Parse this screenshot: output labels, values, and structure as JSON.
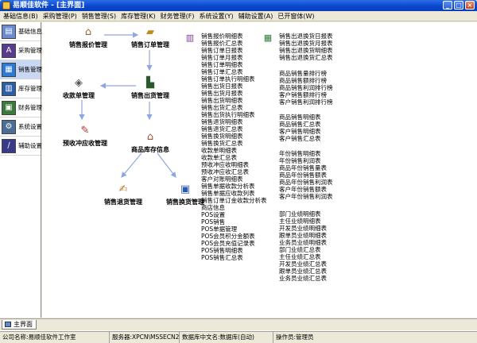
{
  "window": {
    "title": "易顺佳软件 - [主界面]"
  },
  "menu": [
    "基础信息(B)",
    "采购管理(P)",
    "销售管理(S)",
    "库存管理(K)",
    "财务管理(F)",
    "系统设置(Y)",
    "辅助设置(A)",
    "已开窗体(W)"
  ],
  "sidebar": {
    "items": [
      {
        "label": "基础信息",
        "icon": "folder-icon"
      },
      {
        "label": "采购管理",
        "icon": "purchase-icon"
      },
      {
        "label": "销售管理",
        "icon": "sales-icon"
      },
      {
        "label": "库存管理",
        "icon": "stock-icon"
      },
      {
        "label": "财务管理",
        "icon": "finance-icon"
      },
      {
        "label": "系统设置",
        "icon": "settings-icon"
      },
      {
        "label": "辅助设置",
        "icon": "tools-icon"
      }
    ],
    "active_index": 2
  },
  "flow": {
    "quote": "销售报价管理",
    "order": "销售订单管理",
    "receipt": "收款单管理",
    "outbound": "销售出货管理",
    "prepay": "预收冲应收管理",
    "inventory": "商品库存信息",
    "return": "销售退货管理",
    "exchange": "销售换货管理"
  },
  "reports": {
    "col1": [
      "销售报价明细表",
      "销售报价汇总表",
      "销售订单日报表",
      "销售订单月报表",
      "销售订单明细表",
      "销售订单汇总表",
      "销售订单执行明细表",
      "销售出货日报表",
      "销售出货月报表",
      "销售出货明细表",
      "销售出货汇总表",
      "销售出货执行明细表",
      "销售退货明细表",
      "销售退货汇总表",
      "销售换货明细表",
      "销售换货汇总表",
      "收款单明细表",
      "收款单汇总表",
      "预收冲应收明细表",
      "预收冲应收汇总表",
      "客户对账明细表",
      "销售单据收款分析表",
      "销售单据应收款列表",
      "销售订单订金收款分析表",
      "商店信息",
      "POS设置",
      "POS销售",
      "POS单据管理",
      "POS会员积分金额表",
      "POS会员充值记录表",
      "POS销售明细表",
      "POS销售汇总表"
    ],
    "col2_a": [
      "销售出退换货日报表",
      "销售出退换货月报表",
      "销售出退换货明细表",
      "销售出退换货汇总表"
    ],
    "col2_b": [
      "商品销售量排行榜",
      "商品销售额排行榜",
      "商品销售利润排行榜",
      "客户销售额排行榜",
      "客户销售利润排行榜"
    ],
    "col2_c": [
      "商品销售明细表",
      "商品销售汇总表",
      "客户销售明细表",
      "客户销售汇总表"
    ],
    "col2_d": [
      "年份销售明细表",
      "年份销售利润表",
      "商品年份销售量表",
      "商品年份销售额表",
      "商品年份销售利润表",
      "客户年份销售额表",
      "客户年份销售利润表"
    ],
    "col2_e": [
      "部门业绩明细表",
      "主任业绩明细表",
      "开发员业绩明细表",
      "跟单员业绩明细表",
      "业务员业绩明细表",
      "部门业绩汇总表",
      "主任业绩汇总表",
      "开发员业绩汇总表",
      "跟单员业绩汇总表",
      "业务员业绩汇总表"
    ]
  },
  "tab": {
    "label": "主界面"
  },
  "status": {
    "company": "公司名称:易顺佳软件工作室",
    "server": "服务器:XPCN\\MSSECN2000",
    "database": "数据库中文名:数据库(自动)",
    "operator": "操作员:管理员"
  }
}
